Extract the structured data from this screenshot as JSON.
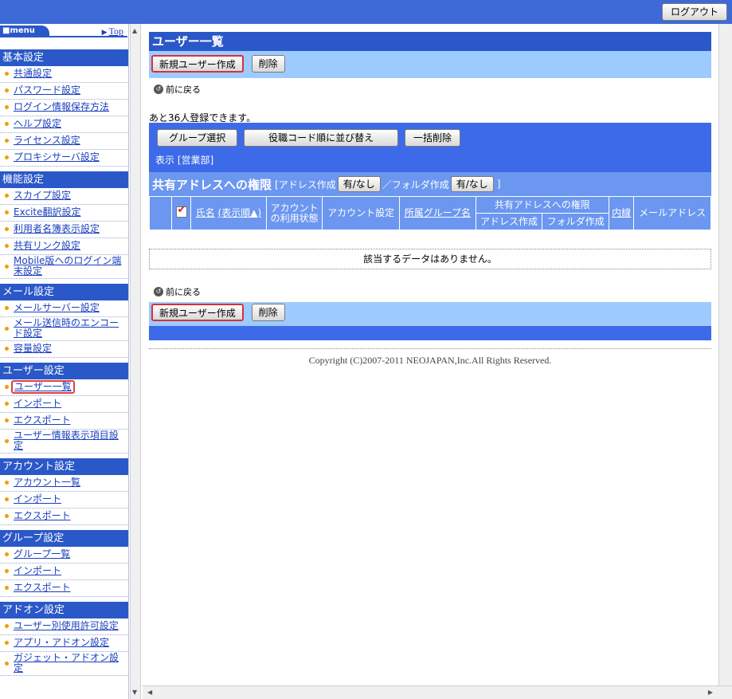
{
  "header": {
    "logout_label": "ログアウト"
  },
  "sidebar": {
    "menu_label": "menu",
    "top_link": "Top",
    "sections": [
      {
        "title": "基本設定",
        "items": [
          "共通設定",
          "パスワード設定",
          "ログイン情報保存方法",
          "ヘルプ設定",
          "ライセンス設定",
          "プロキシサーバ設定"
        ]
      },
      {
        "title": "機能設定",
        "items": [
          "スカイプ設定",
          "Excite翻訳設定",
          "利用者名簿表示設定",
          "共有リンク設定",
          "Mobile版へのログイン端末設定"
        ]
      },
      {
        "title": "メール設定",
        "items": [
          "メールサーバー設定",
          "メール送信時のエンコード設定",
          "容量設定"
        ]
      },
      {
        "title": "ユーザー設定",
        "items": [
          "ユーザー一覧",
          "インポート",
          "エクスポート",
          "ユーザー情報表示項目設定"
        ]
      },
      {
        "title": "アカウント設定",
        "items": [
          "アカウント一覧",
          "インポート",
          "エクスポート"
        ]
      },
      {
        "title": "グループ設定",
        "items": [
          "グループ一覧",
          "インポート",
          "エクスポート"
        ]
      },
      {
        "title": "アドオン設定",
        "items": [
          "ユーザー別使用許可設定",
          "アプリ・アドオン設定",
          "ガジェット・アドオン設定"
        ]
      }
    ]
  },
  "main": {
    "title": "ユーザー一覧",
    "new_user_button": "新規ユーザー作成",
    "delete_button": "削除",
    "back_label": "前に戻る",
    "quota_text": "あと36人登録できます。",
    "filter": {
      "group_select": "グループ選択",
      "sort_button": "役職コード順に並び替え",
      "bulk_delete": "一括削除",
      "display_text": "表示 [営業部]"
    },
    "perm": {
      "title": "共有アドレスへの権限",
      "address_create_prefix": "[アドレス作成",
      "toggle_label": "有/なし",
      "folder_create_prefix": "／フォルダ作成",
      "suffix": "]"
    },
    "table": {
      "col_name": "氏名",
      "col_sort": "(表示順▲)",
      "col_account_status_1": "アカウント",
      "col_account_status_2": "の利用状態",
      "col_account_setting": "アカウント設定",
      "col_group": "所属グループ名",
      "col_perm": "共有アドレスへの権限",
      "col_perm_address": "アドレス作成",
      "col_perm_folder": "フォルダ作成",
      "col_extension": "内線",
      "col_mail": "メールアドレス"
    },
    "no_data": "該当するデータはありません。",
    "copyright": "Copyright (C)2007-2011 NEOJAPAN,Inc.All Rights Reserved."
  }
}
